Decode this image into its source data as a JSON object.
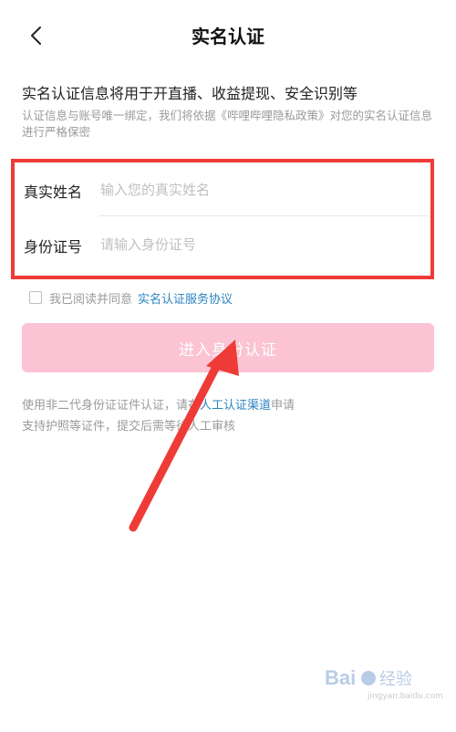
{
  "header": {
    "title": "实名认证",
    "back_icon": "chevron-left-icon"
  },
  "intro": {
    "main": "实名认证信息将用于开直播、收益提现、安全识别等",
    "sub": "认证信息与账号唯一绑定，我们将依据《哔哩哔哩隐私政策》对您的实名认证信息进行严格保密"
  },
  "form": {
    "name_label": "真实姓名",
    "name_placeholder": "输入您的真实姓名",
    "id_label": "身份证号",
    "id_placeholder": "请输入身份证号"
  },
  "agreement": {
    "text": "我已阅读并同意",
    "link": "实名认证服务协议",
    "checked": false
  },
  "submit": {
    "label": "进入身份认证"
  },
  "notes": {
    "line1_prefix": "使用非二代身份证证件认证，请在",
    "line1_link": "人工认证渠道",
    "line1_suffix": "申请",
    "line2": "支持护照等证件，提交后需等待人工审核"
  },
  "annotation": {
    "highlight_color": "#ee3b37",
    "arrow_color": "#ee3b37"
  },
  "watermark": {
    "line2": "jingyan.baidu.com"
  },
  "colors": {
    "link": "#2b84c2",
    "button_disabled": "#fbc3d3",
    "placeholder": "#c0c0c0"
  }
}
